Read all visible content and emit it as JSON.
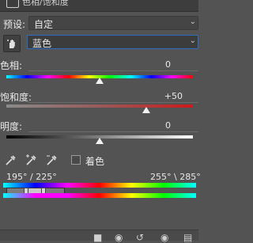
{
  "title": "色相/饱和度",
  "preset": {
    "label": "预设:",
    "value": "自定"
  },
  "channel": {
    "value": "蓝色"
  },
  "hue": {
    "label": "色相:",
    "value": "0",
    "level": 0.5
  },
  "saturation": {
    "label": "饱和度:",
    "value": "+50",
    "level": 0.75
  },
  "lightness": {
    "label": "明度:",
    "value": "0",
    "level": 0.5
  },
  "colorize": {
    "label": "着色",
    "checked": false
  },
  "range": {
    "left": "195° / 225°",
    "right": "255° \\ 285°"
  },
  "colors": {
    "accent": "#2c6fc0",
    "panel": "#535353"
  },
  "icons": [
    "target-hand-icon",
    "eyedropper-icon",
    "eyedropper-plus-icon",
    "eyedropper-minus-icon",
    "clip-to-layer-icon",
    "view-previous-icon",
    "reset-icon",
    "visibility-eye-icon",
    "trash-icon"
  ]
}
